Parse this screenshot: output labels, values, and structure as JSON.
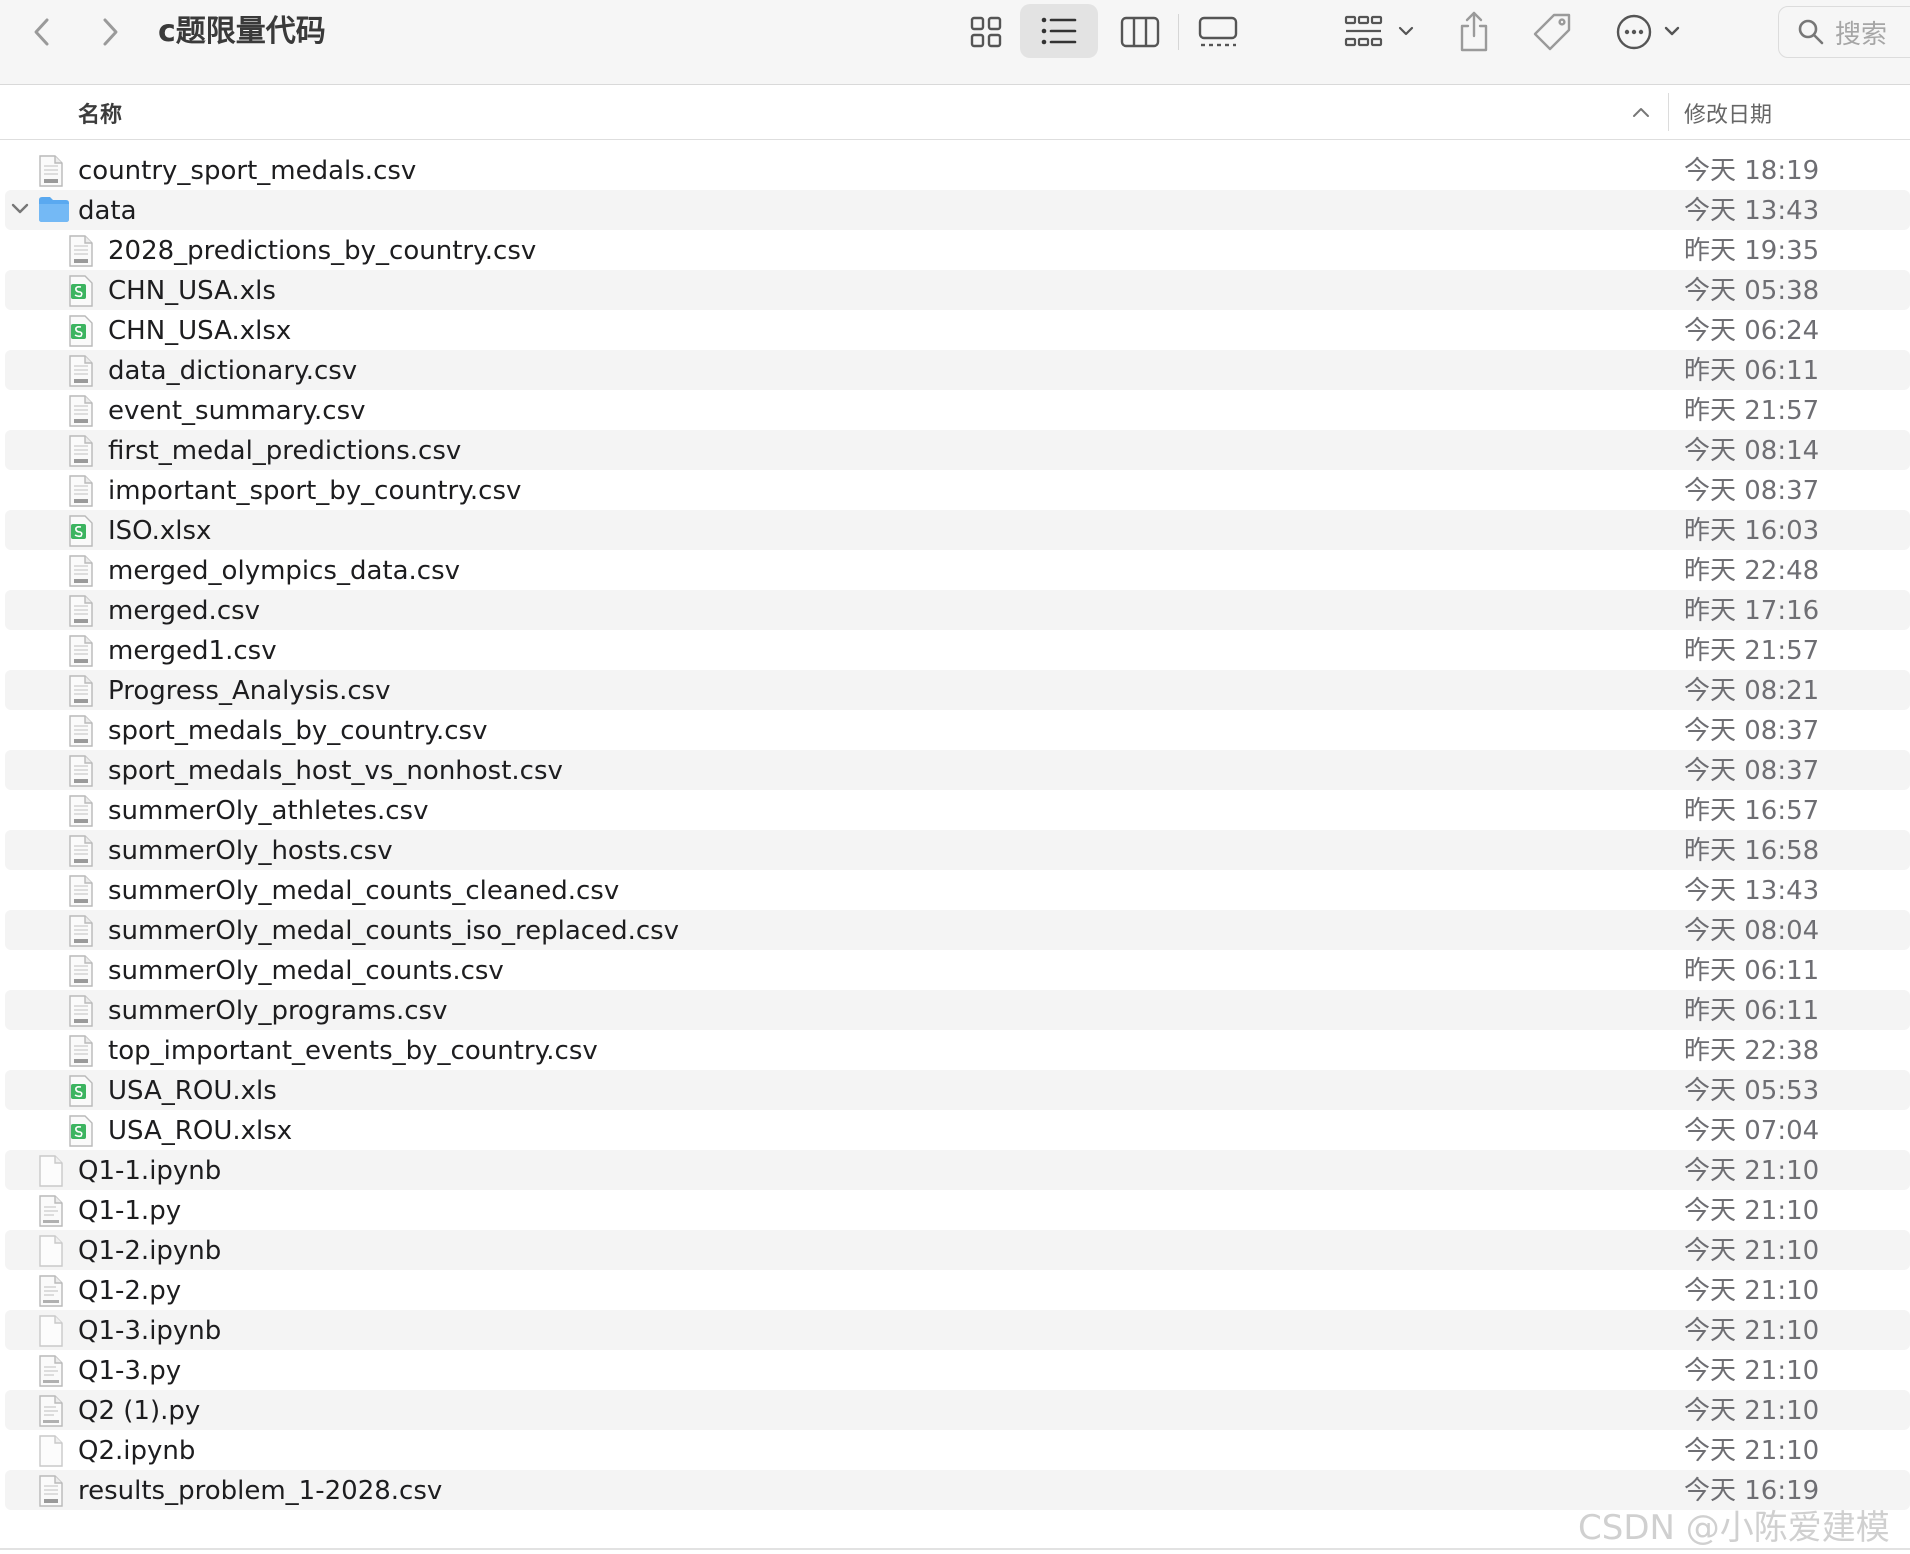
{
  "window": {
    "title": "c题限量代码"
  },
  "search": {
    "placeholder": "搜索"
  },
  "columns": {
    "name": "名称",
    "date_modified": "修改日期"
  },
  "icons": {
    "back": "chevron-left-icon",
    "forward": "chevron-right-icon",
    "icon_view": "grid-icon",
    "list_view": "list-icon",
    "column_view": "columns-icon",
    "gallery_view": "gallery-icon",
    "group": "group-icon",
    "share": "share-icon",
    "tag": "tag-icon",
    "more": "ellipsis-icon",
    "search": "search-icon",
    "folder": "folder-icon",
    "csv": "csv-file-icon",
    "xls": "spreadsheet-file-icon",
    "py": "python-file-icon",
    "ipynb": "blank-file-icon"
  },
  "files": [
    {
      "name": "country_sport_medals.csv",
      "date": "今天 18:19",
      "kind": "csv",
      "level": 0
    },
    {
      "name": "data",
      "date": "今天 13:43",
      "kind": "folder",
      "level": 0,
      "expanded": true
    },
    {
      "name": "2028_predictions_by_country.csv",
      "date": "昨天 19:35",
      "kind": "csv",
      "level": 1
    },
    {
      "name": "CHN_USA.xls",
      "date": "今天 05:38",
      "kind": "xls",
      "level": 1
    },
    {
      "name": "CHN_USA.xlsx",
      "date": "今天 06:24",
      "kind": "xls",
      "level": 1
    },
    {
      "name": "data_dictionary.csv",
      "date": "昨天 06:11",
      "kind": "csv",
      "level": 1
    },
    {
      "name": "event_summary.csv",
      "date": "昨天 21:57",
      "kind": "csv",
      "level": 1
    },
    {
      "name": "first_medal_predictions.csv",
      "date": "今天 08:14",
      "kind": "csv",
      "level": 1
    },
    {
      "name": "important_sport_by_country.csv",
      "date": "今天 08:37",
      "kind": "csv",
      "level": 1
    },
    {
      "name": "ISO.xlsx",
      "date": "昨天 16:03",
      "kind": "xls",
      "level": 1
    },
    {
      "name": "merged_olympics_data.csv",
      "date": "昨天 22:48",
      "kind": "csv",
      "level": 1
    },
    {
      "name": "merged.csv",
      "date": "昨天 17:16",
      "kind": "csv",
      "level": 1
    },
    {
      "name": "merged1.csv",
      "date": "昨天 21:57",
      "kind": "csv",
      "level": 1
    },
    {
      "name": "Progress_Analysis.csv",
      "date": "今天 08:21",
      "kind": "csv",
      "level": 1
    },
    {
      "name": "sport_medals_by_country.csv",
      "date": "今天 08:37",
      "kind": "csv",
      "level": 1
    },
    {
      "name": "sport_medals_host_vs_nonhost.csv",
      "date": "今天 08:37",
      "kind": "csv",
      "level": 1
    },
    {
      "name": "summerOly_athletes.csv",
      "date": "昨天 16:57",
      "kind": "csv",
      "level": 1
    },
    {
      "name": "summerOly_hosts.csv",
      "date": "昨天 16:58",
      "kind": "csv",
      "level": 1
    },
    {
      "name": "summerOly_medal_counts_cleaned.csv",
      "date": "今天 13:43",
      "kind": "csv",
      "level": 1
    },
    {
      "name": "summerOly_medal_counts_iso_replaced.csv",
      "date": "今天 08:04",
      "kind": "csv",
      "level": 1
    },
    {
      "name": "summerOly_medal_counts.csv",
      "date": "昨天 06:11",
      "kind": "csv",
      "level": 1
    },
    {
      "name": "summerOly_programs.csv",
      "date": "昨天 06:11",
      "kind": "csv",
      "level": 1
    },
    {
      "name": "top_important_events_by_country.csv",
      "date": "昨天 22:38",
      "kind": "csv",
      "level": 1
    },
    {
      "name": "USA_ROU.xls",
      "date": "今天 05:53",
      "kind": "xls",
      "level": 1
    },
    {
      "name": "USA_ROU.xlsx",
      "date": "今天 07:04",
      "kind": "xls",
      "level": 1
    },
    {
      "name": "Q1-1.ipynb",
      "date": "今天 21:10",
      "kind": "ipynb",
      "level": 0
    },
    {
      "name": "Q1-1.py",
      "date": "今天 21:10",
      "kind": "py",
      "level": 0
    },
    {
      "name": "Q1-2.ipynb",
      "date": "今天 21:10",
      "kind": "ipynb",
      "level": 0
    },
    {
      "name": "Q1-2.py",
      "date": "今天 21:10",
      "kind": "py",
      "level": 0
    },
    {
      "name": "Q1-3.ipynb",
      "date": "今天 21:10",
      "kind": "ipynb",
      "level": 0
    },
    {
      "name": "Q1-3.py",
      "date": "今天 21:10",
      "kind": "py",
      "level": 0
    },
    {
      "name": "Q2 (1).py",
      "date": "今天 21:10",
      "kind": "py",
      "level": 0
    },
    {
      "name": "Q2.ipynb",
      "date": "今天 21:10",
      "kind": "ipynb",
      "level": 0
    },
    {
      "name": "results_problem_1-2028.csv",
      "date": "今天 16:19",
      "kind": "csv",
      "level": 0
    }
  ],
  "watermark": "CSDN @小陈爱建模",
  "colors": {
    "folder": "#5aa9f0",
    "spreadsheet": "#3cb460",
    "toolbar_bg": "#f6f6f6",
    "row_alt": "#f4f4f4"
  }
}
